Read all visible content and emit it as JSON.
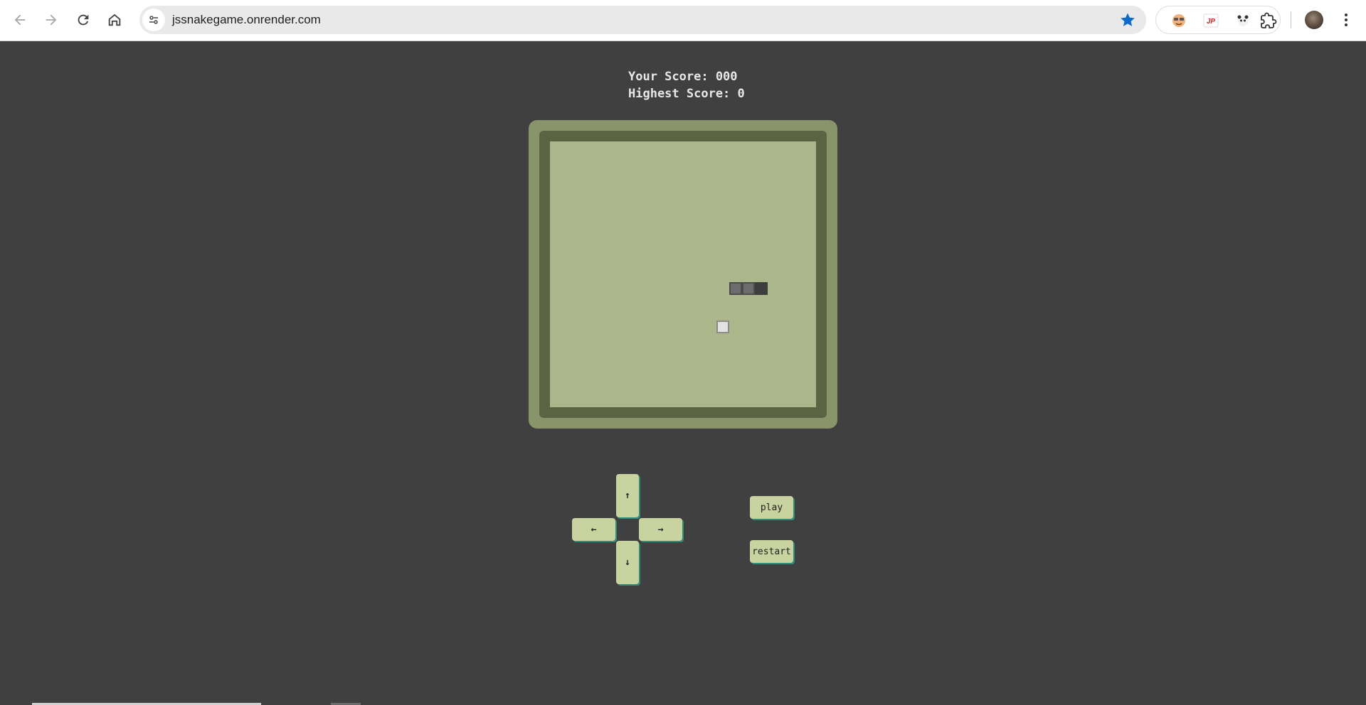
{
  "browser": {
    "url": "jssnakegame.onrender.com",
    "icons": {
      "back": "arrow-left-icon",
      "forward": "arrow-right-icon",
      "reload": "reload-icon",
      "home": "home-icon",
      "site_info": "tune-icon",
      "bookmark": "star-icon",
      "extensions": "puzzle-icon",
      "menu": "kebab-menu-icon"
    },
    "bookmark_color": "#0b6bcb"
  },
  "game": {
    "score_label": "Your Score: 000",
    "high_score_label": "Highest Score: 0",
    "grid_size": 20,
    "snake": [
      {
        "col": 14,
        "row": 11,
        "part": "body"
      },
      {
        "col": 15,
        "row": 11,
        "part": "body"
      },
      {
        "col": 16,
        "row": 11,
        "part": "head"
      }
    ],
    "food": {
      "col": 13,
      "row": 14
    },
    "colors": {
      "background": "#404040",
      "console": "#8a946b",
      "bezel": "#5c6342",
      "screen": "#abb78a",
      "button": "#c8d3a0",
      "button_shadow": "#2f8f7a"
    }
  },
  "controls": {
    "up": "↑",
    "left": "←",
    "right": "→",
    "down": "↓",
    "play": "play",
    "restart": "restart"
  }
}
